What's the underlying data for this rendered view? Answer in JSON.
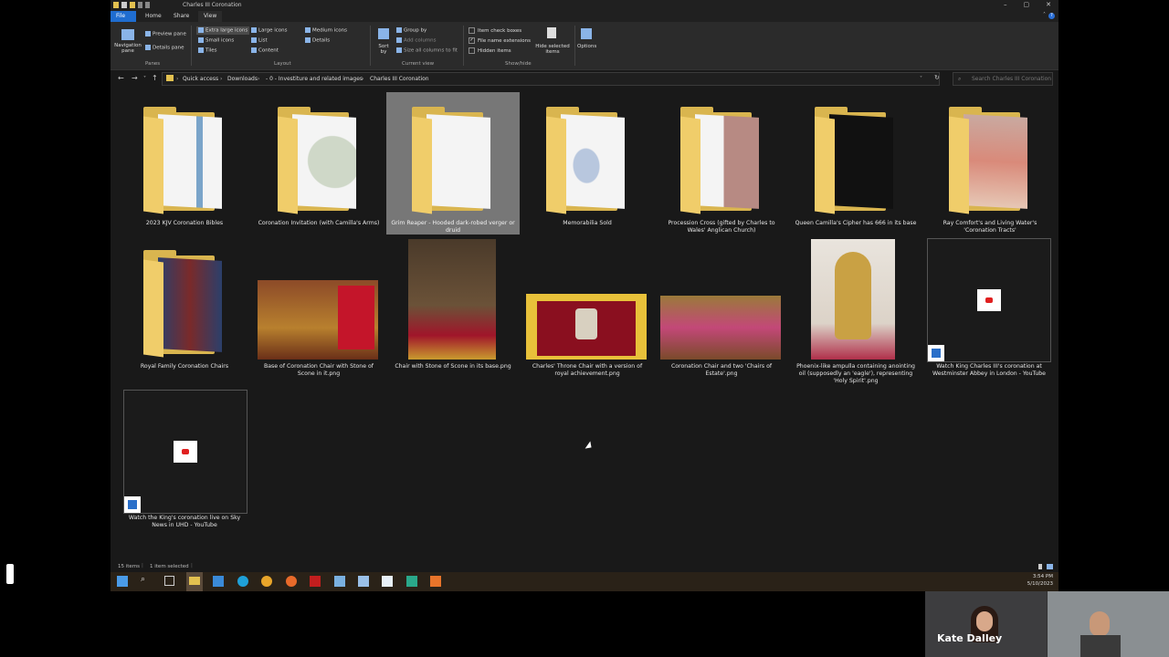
{
  "window": {
    "title": "Charles III Coronation",
    "controls": [
      "–",
      "▢",
      "✕"
    ]
  },
  "ribbon_tabs": [
    "File",
    "Home",
    "Share",
    "View"
  ],
  "ribbon": {
    "panes": {
      "navigation_pane": "Navigation pane",
      "preview_pane": "Preview pane",
      "details_pane": "Details pane",
      "group": "Panes"
    },
    "layout": {
      "options": [
        "Extra large icons",
        "Large icons",
        "Medium icons",
        "Small icons",
        "List",
        "Details",
        "Tiles",
        "Content"
      ],
      "selected": "Extra large icons",
      "group": "Layout"
    },
    "current_view": {
      "sort_by": "Sort by",
      "group_by": "Group by",
      "add_columns": "Add columns",
      "size_columns": "Size all columns to fit",
      "group": "Current view"
    },
    "show_hide": {
      "item_check_boxes": "Item check boxes",
      "file_name_extensions": "File name extensions",
      "hidden_items": "Hidden items",
      "hide_selected": "Hide selected items",
      "group": "Show/hide",
      "checked": {
        "item_check_boxes": false,
        "file_name_extensions": true,
        "hidden_items": false
      }
    },
    "options": "Options"
  },
  "address": {
    "crumbs": [
      "Quick access",
      "Downloads",
      "- 0 - Investiture and related images",
      "Charles III Coronation"
    ],
    "search_placeholder": "Search Charles III Coronation"
  },
  "items": [
    {
      "label": "2023 KJV Coronation Bibles",
      "kind": "folder"
    },
    {
      "label": "Coronation Invitation (with Camilla's Arms)",
      "kind": "folder"
    },
    {
      "label": "Grim Reaper - Hooded dark-robed verger or druid",
      "kind": "folder",
      "selected": true
    },
    {
      "label": "Memorabilia Sold",
      "kind": "folder"
    },
    {
      "label": "Procession Cross (gifted by Charles to Wales' Anglican Church)",
      "kind": "folder"
    },
    {
      "label": "Queen Camilla's Cipher has 666 in its base",
      "kind": "folder"
    },
    {
      "label": "Ray Comfort's and Living Water's 'Coronation Tracts'",
      "kind": "folder"
    },
    {
      "label": "Royal Family Coronation Chairs",
      "kind": "folder"
    },
    {
      "label": "Base of Coronation Chair with Stone of Scone in it.png",
      "kind": "image"
    },
    {
      "label": "Chair with Stone of Scone in its base.png",
      "kind": "image"
    },
    {
      "label": "Charles' Throne Chair with a version of royal achievement.png",
      "kind": "image"
    },
    {
      "label": "Coronation Chair and two 'Chairs of Estate'.png",
      "kind": "image"
    },
    {
      "label": "Phoenix-like ampulla containing anointing oil (supposedly an 'eagle'), representing 'Holy Spirit'.png",
      "kind": "image"
    },
    {
      "label": "Watch King Charles III's coronation at Westminster Abbey in London - YouTube",
      "kind": "shortcut"
    },
    {
      "label": "Watch the King's coronation live on Sky News in UHD - YouTube",
      "kind": "shortcut"
    }
  ],
  "status": {
    "count": "15 items",
    "selected": "1 item selected"
  },
  "tray": {
    "time": "3:54 PM",
    "date": "5/10/2023"
  },
  "video": {
    "participant_name": "Kate Dalley"
  },
  "colors": {
    "folder": "#d9b54f",
    "selection": "#777777",
    "accent": "#1f6dd0",
    "youtube": "#e02020"
  }
}
